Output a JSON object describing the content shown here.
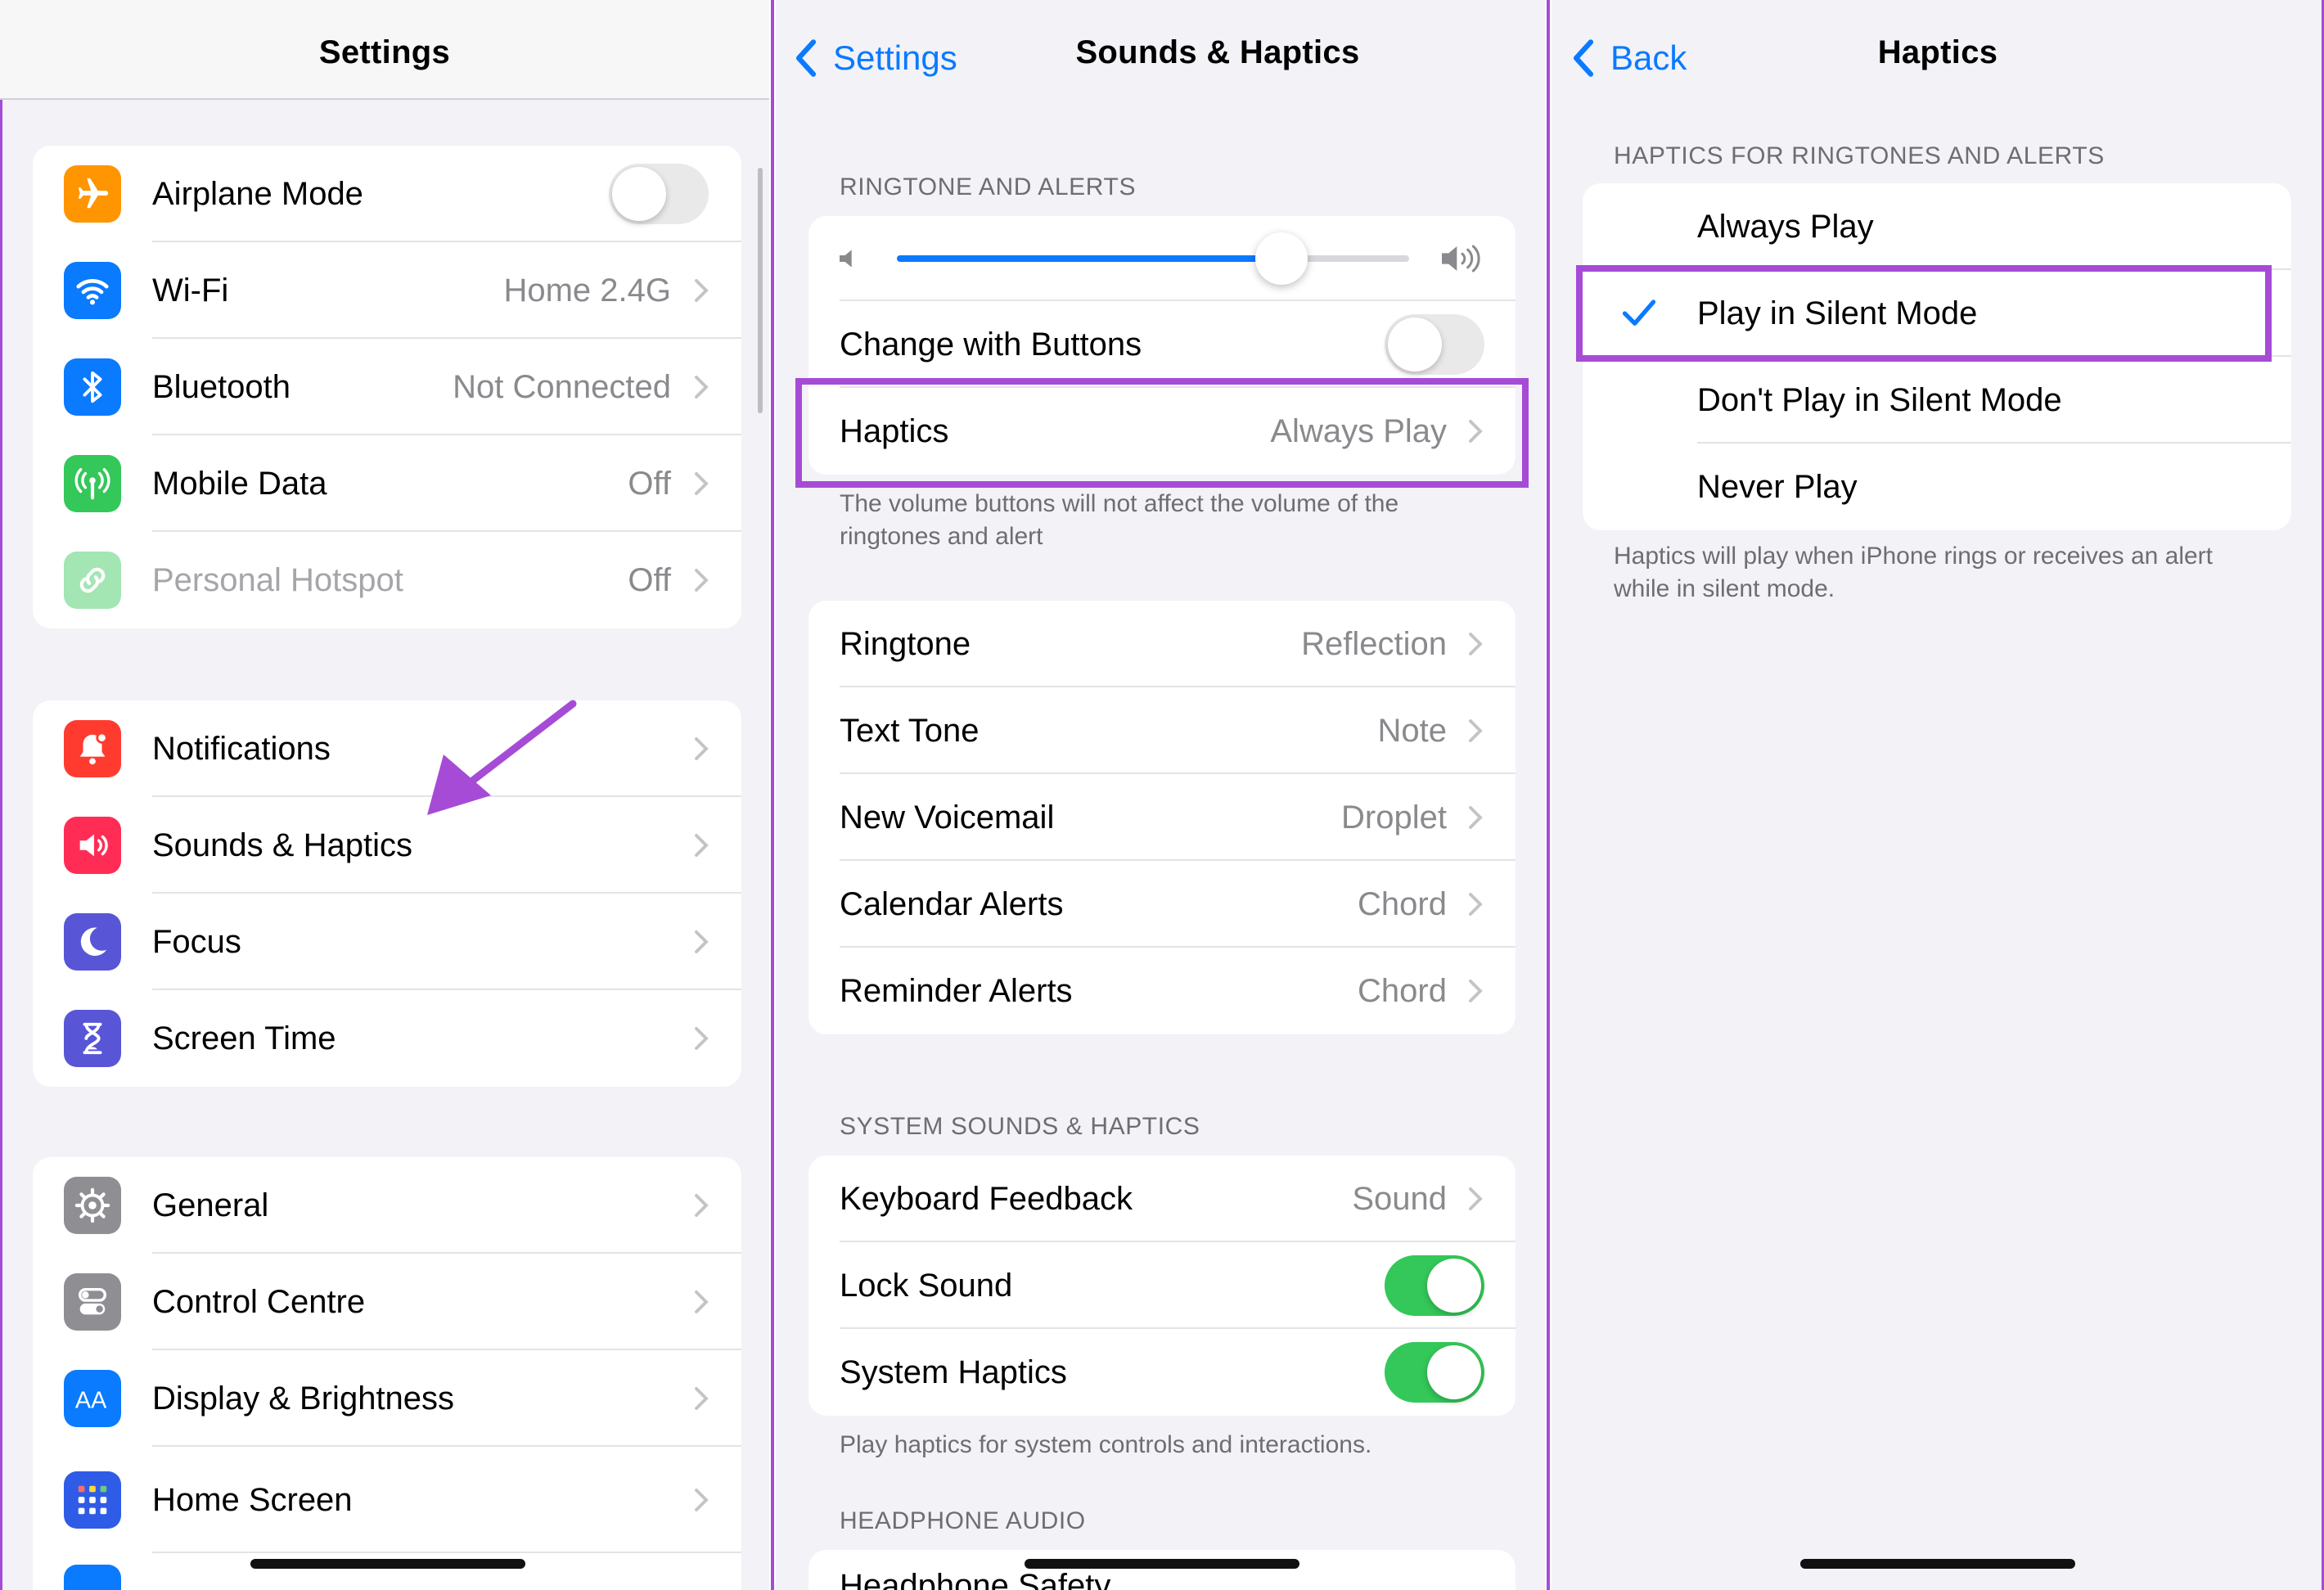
{
  "settings": {
    "title": "Settings",
    "group1": [
      {
        "label": "Airplane Mode",
        "value": "",
        "icon": "airplane-icon",
        "color": "#ff9500",
        "control": "toggle-off"
      },
      {
        "label": "Wi-Fi",
        "value": "Home 2.4G",
        "icon": "wifi-icon",
        "color": "#0a7aff"
      },
      {
        "label": "Bluetooth",
        "value": "Not Connected",
        "icon": "bluetooth-icon",
        "color": "#0a7aff"
      },
      {
        "label": "Mobile Data",
        "value": "Off",
        "icon": "antenna-icon",
        "color": "#34c759"
      },
      {
        "label": "Personal Hotspot",
        "value": "Off",
        "icon": "link-icon",
        "color": "#34c759",
        "dimmed": true
      }
    ],
    "group2": [
      {
        "label": "Notifications",
        "icon": "bell-icon",
        "color": "#ff3b30"
      },
      {
        "label": "Sounds & Haptics",
        "icon": "speaker-icon",
        "color": "#ff2d55"
      },
      {
        "label": "Focus",
        "icon": "moon-icon",
        "color": "#5856d6"
      },
      {
        "label": "Screen Time",
        "icon": "hourglass-icon",
        "color": "#5856d6"
      }
    ],
    "group3": [
      {
        "label": "General",
        "icon": "gear-icon",
        "color": "#8e8e93"
      },
      {
        "label": "Control Centre",
        "icon": "switches-icon",
        "color": "#8e8e93"
      },
      {
        "label": "Display & Brightness",
        "icon": "text-size-icon",
        "color": "#0a7aff"
      },
      {
        "label": "Home Screen",
        "icon": "grid-icon",
        "color": "#2f5ce6"
      }
    ]
  },
  "sounds": {
    "back_label": "Settings",
    "title": "Sounds & Haptics",
    "ringtone_header": "RINGTONE AND ALERTS",
    "volume_level": 0.75,
    "change_with_buttons": "Change with Buttons",
    "haptics_label": "Haptics",
    "haptics_value": "Always Play",
    "volume_footer": "The volume buttons will not affect the volume of the ringtones and alert",
    "tones": [
      {
        "label": "Ringtone",
        "value": "Reflection"
      },
      {
        "label": "Text Tone",
        "value": "Note"
      },
      {
        "label": "New Voicemail",
        "value": "Droplet"
      },
      {
        "label": "Calendar Alerts",
        "value": "Chord"
      },
      {
        "label": "Reminder Alerts",
        "value": "Chord"
      }
    ],
    "system_header": "SYSTEM SOUNDS & HAPTICS",
    "keyboard_feedback": "Keyboard Feedback",
    "keyboard_value": "Sound",
    "lock_sound": "Lock Sound",
    "system_haptics": "System Haptics",
    "system_footer": "Play haptics for system controls and interactions.",
    "headphone_header": "HEADPHONE AUDIO",
    "headphone_safety": "Headphone Safety"
  },
  "haptics": {
    "back_label": "Back",
    "title": "Haptics",
    "header": "HAPTICS FOR RINGTONES AND ALERTS",
    "options": [
      "Always Play",
      "Play in Silent Mode",
      "Don't Play in Silent Mode",
      "Never Play"
    ],
    "selected": "Play in Silent Mode",
    "footer": "Haptics will play when iPhone rings or receives an alert while in silent mode."
  },
  "colors": {
    "accent": "#0a7aff",
    "highlight": "#a64bd6",
    "toggle_on": "#34c759",
    "background": "#f2f2f7"
  }
}
